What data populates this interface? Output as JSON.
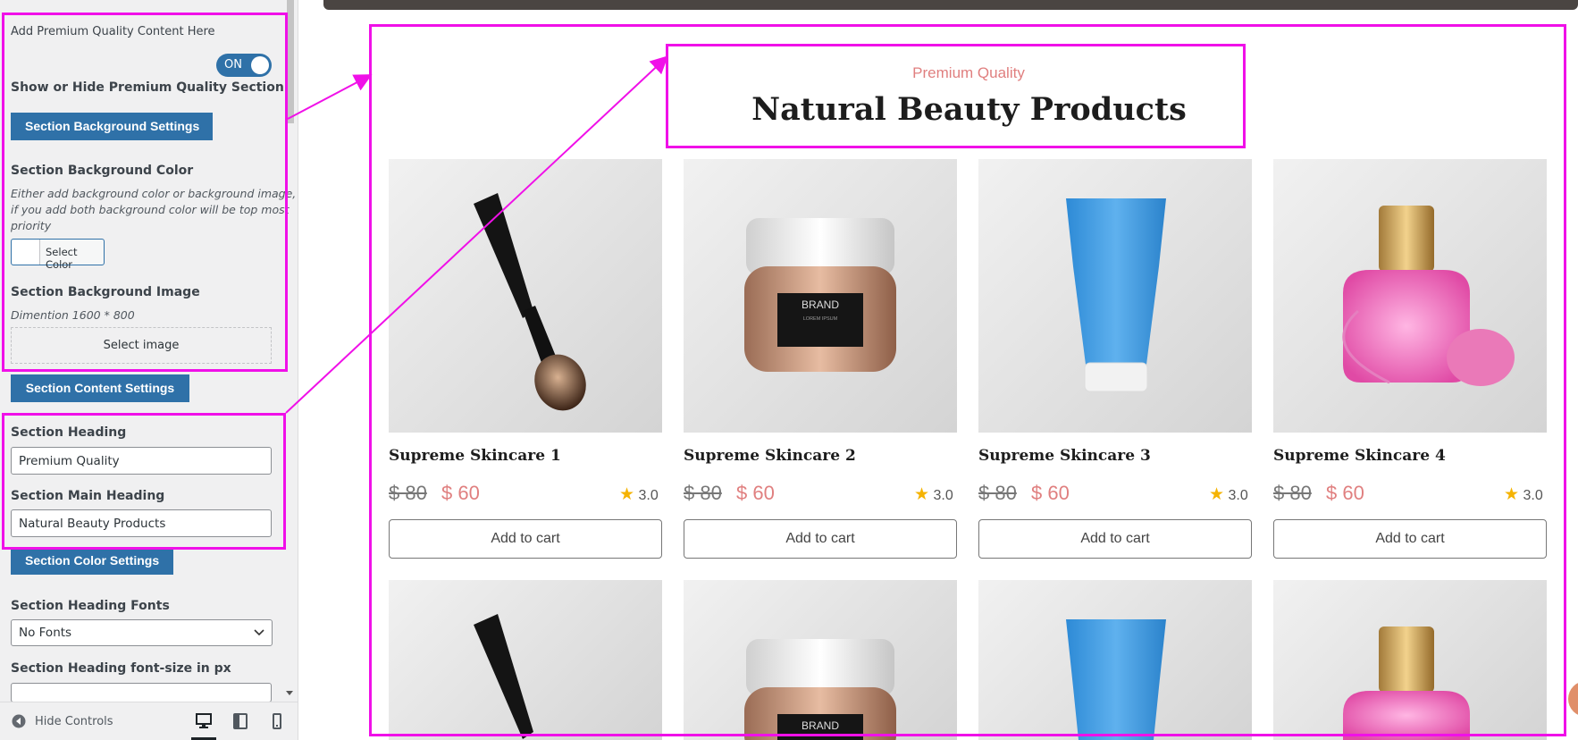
{
  "customizer": {
    "intro_label": "Add Premium Quality Content Here",
    "toggle_text": "ON",
    "toggle_state": true,
    "show_hide_label": "Show or Hide Premium Quality Section",
    "bg_settings_button": "Section Background Settings",
    "bg_color_title": "Section Background Color",
    "bg_color_desc_line1": "Either add background color or background image,",
    "bg_color_desc_line2": "if you add both background color will be top most",
    "bg_color_desc_line3": "priority",
    "select_color_label": "Select Color",
    "bg_image_title": "Section Background Image",
    "bg_image_desc": "Dimention 1600 * 800",
    "select_image_label": "Select image",
    "content_settings_button": "Section Content Settings",
    "heading_label": "Section Heading",
    "heading_value": "Premium Quality",
    "main_heading_label": "Section Main Heading",
    "main_heading_value": "Natural Beauty Products",
    "color_settings_button": "Section Color Settings",
    "heading_fonts_label": "Section Heading Fonts",
    "heading_fonts_value": "No Fonts",
    "font_size_label": "Section Heading font-size in px",
    "font_size_value": "",
    "hide_controls_label": "Hide Controls"
  },
  "preview": {
    "subheading": "Premium Quality",
    "heading": "Natural Beauty Products",
    "products": [
      {
        "title": "Supreme Skincare 1",
        "old_price": "$ 80",
        "new_price": "$ 60",
        "rating": "3.0",
        "button": "Add to cart",
        "image": "makeup-brush"
      },
      {
        "title": "Supreme Skincare 2",
        "old_price": "$ 80",
        "new_price": "$ 60",
        "rating": "3.0",
        "button": "Add to cart",
        "image": "cream-jar"
      },
      {
        "title": "Supreme Skincare 3",
        "old_price": "$ 80",
        "new_price": "$ 60",
        "rating": "3.0",
        "button": "Add to cart",
        "image": "lotion-tube"
      },
      {
        "title": "Supreme Skincare 4",
        "old_price": "$ 80",
        "new_price": "$ 60",
        "rating": "3.0",
        "button": "Add to cart",
        "image": "perfume-bottle"
      }
    ],
    "jar_brand": "BRAND",
    "jar_sub": "LOREM IPSUM"
  },
  "colors": {
    "highlight": "#f010e8",
    "button_blue": "#2f71a8",
    "price_accent": "#e07f7f",
    "star": "#f5b301"
  }
}
